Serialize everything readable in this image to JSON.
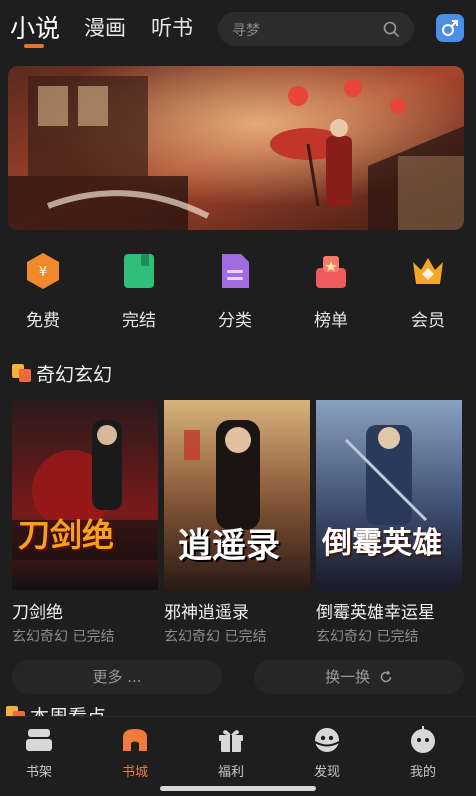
{
  "header": {
    "tabs": [
      {
        "label": "小说",
        "active": true
      },
      {
        "label": "漫画",
        "active": false
      },
      {
        "label": "听书",
        "active": false
      }
    ],
    "search_placeholder": "寻梦",
    "accent_color": "#e8722f"
  },
  "categories": [
    {
      "label": "免费",
      "icon": "coin-hexagon-icon",
      "color": "#f08a2c"
    },
    {
      "label": "完结",
      "icon": "book-icon",
      "color": "#2fbf7a"
    },
    {
      "label": "分类",
      "icon": "document-icon",
      "color": "#a36be0"
    },
    {
      "label": "榜单",
      "icon": "ranking-icon",
      "color": "#f05a5a"
    },
    {
      "label": "会员",
      "icon": "crown-icon",
      "color": "#f5a623"
    }
  ],
  "section": {
    "title": "奇幻玄幻",
    "books": [
      {
        "title": "刀剑绝",
        "meta": "玄幻奇幻 已完结",
        "cover_text": "刀剑绝"
      },
      {
        "title": "邪神逍遥录",
        "meta": "玄幻奇幻 已完结",
        "cover_text": "逍遥录"
      },
      {
        "title": "倒霉英雄幸运星",
        "meta": "玄幻奇幻 已完结",
        "cover_text": "倒霉英雄"
      }
    ],
    "more_label": "更多 ...",
    "refresh_label": "换一换"
  },
  "next_section_title": "本周看点",
  "bottom_nav": [
    {
      "label": "书架",
      "icon": "bookshelf-icon",
      "active": false
    },
    {
      "label": "书城",
      "icon": "bookstore-icon",
      "active": true
    },
    {
      "label": "福利",
      "icon": "gift-icon",
      "active": false
    },
    {
      "label": "发现",
      "icon": "discover-icon",
      "active": false
    },
    {
      "label": "我的",
      "icon": "profile-icon",
      "active": false
    }
  ]
}
